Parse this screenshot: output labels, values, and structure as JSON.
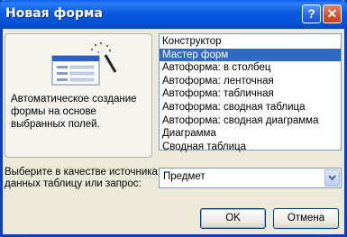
{
  "window": {
    "title": "Новая форма",
    "help_glyph": "?",
    "close_glyph": "✕"
  },
  "preview": {
    "description": "Автоматическое создание формы на основе выбранных полей."
  },
  "form_types": {
    "items": [
      {
        "label": "Конструктор"
      },
      {
        "label": "Мастер форм"
      },
      {
        "label": "Автоформа: в столбец"
      },
      {
        "label": "Автоформа: ленточная"
      },
      {
        "label": "Автоформа: табличная"
      },
      {
        "label": "Автоформа:  сводная таблица"
      },
      {
        "label": "Автоформа:  сводная диаграмма"
      },
      {
        "label": "Диаграмма"
      },
      {
        "label": "Сводная таблица"
      }
    ],
    "selected_index": 1
  },
  "source": {
    "label": "Выберите в качестве источника данных таблицу или запрос:",
    "value": "Предмет"
  },
  "buttons": {
    "ok": "OK",
    "cancel": "Отмена"
  },
  "colors": {
    "titlebar": "#0a5ae0",
    "selection": "#316ac5",
    "dialog_bg": "#ece9d8"
  }
}
